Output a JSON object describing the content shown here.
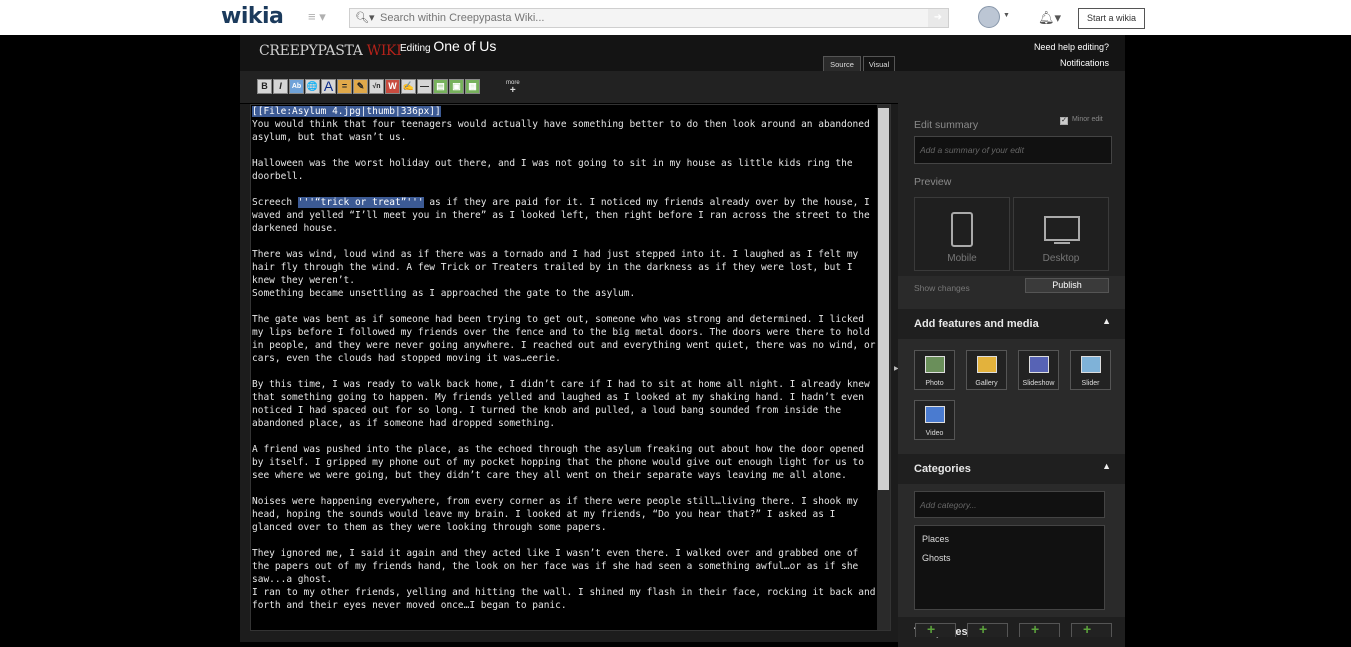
{
  "global_nav": {
    "logo": "wikia",
    "menu_icon": "≡ ▾",
    "search_placeholder": "Search within Creepypasta Wiki...",
    "start_wiki": "Start a wikia"
  },
  "header": {
    "wiki_name_part1": "CREEPYPASTA ",
    "wiki_name_part2": "WIKI",
    "editing_label": "Editing",
    "page_title": "One of Us",
    "help_link": "Need help editing?",
    "notifications": "Notifications"
  },
  "tabs": {
    "source": "Source",
    "visual": "Visual"
  },
  "toolbar": {
    "more_label": "more",
    "more_plus": "+",
    "buttons": [
      "B",
      "I",
      "Ab",
      "🌐",
      "A",
      "=",
      "✎",
      "√n",
      "W",
      "✍",
      "—",
      "▤",
      "▣",
      "▦"
    ]
  },
  "editor": {
    "lines": [
      {
        "pre": "",
        "hl": "[[File:Asylum 4.jpg|thumb|336px]]",
        "post": "\nYou would think that four teenagers would actually have something better to do then look around an abandoned asylum, but that wasn’t us."
      },
      {
        "pre": "Halloween was the worst holiday out there, and I was not going to sit in my house as little kids ring the doorbell.",
        "hl": "",
        "post": ""
      },
      {
        "pre": "Screech ",
        "hl": "'''“trick or treat”'''",
        "post": " as if they are paid for it. I noticed my friends already over by the house, I waved and yelled “I’ll meet you in there” as I looked left, then right before I ran across the street to the darkened house."
      },
      {
        "pre": "There was wind, loud wind as if there was a tornado and I had just stepped into it. I laughed as I felt my hair fly through the wind. A few Trick or Treaters trailed by in the darkness as if they were lost, but I knew they weren’t.\nSomething became unsettling as I approached the gate to the asylum.",
        "hl": "",
        "post": ""
      },
      {
        "pre": "The gate was bent as if someone had been trying to get out, someone who was strong and determined. I licked my lips before I followed my friends over the fence and to the big metal doors. The doors were there to hold in people, and they were never going anywhere. I reached out and everything went quiet, there was no wind, or cars, even the clouds had stopped moving it was…eerie.",
        "hl": "",
        "post": ""
      },
      {
        "pre": "By this time, I was ready to walk back home, I didn’t care if I had to sit at home all night. I already knew that something going to happen. My friends yelled and laughed as I looked at my shaking hand. I hadn’t even noticed I had spaced out for so long. I turned the knob and pulled, a loud bang sounded from inside the abandoned place, as if someone had dropped something.",
        "hl": "",
        "post": ""
      },
      {
        "pre": "A friend was pushed into the place, as the echoed through the asylum freaking out about how the door opened by itself. I gripped my phone out of my pocket hopping that the phone would give out enough light for us to see where we were going, but they didn’t care they all went on their separate ways leaving me all alone.",
        "hl": "",
        "post": ""
      },
      {
        "pre": "Noises were happening everywhere, from every corner as if there were people still…living there. I shook my head, hoping the sounds would leave my brain. I looked at my friends, “Do you hear that?” I asked as I glanced over to them as they were looking through some papers.",
        "hl": "",
        "post": ""
      },
      {
        "pre": "They ignored me, I said it again and they acted like I wasn’t even there. I walked over and grabbed one of the papers out of my friends hand, the look on her face was if she had seen a something awful…or as if she saw...a ghost.\nI ran to my other friends, yelling and hitting the wall. I shined my flash in their face, rocking it back and forth and their eyes never moved once…I began to panic.",
        "hl": "",
        "post": ""
      }
    ]
  },
  "rail": {
    "edit_summary_label": "Edit summary",
    "minor_edit": "Minor edit",
    "summary_placeholder": "Add a summary of your edit",
    "preview_label": "Preview",
    "mobile": "Mobile",
    "desktop": "Desktop",
    "show_changes": "Show changes",
    "publish": "Publish",
    "features_title": "Add features and media",
    "media": [
      "Photo",
      "Gallery",
      "Slideshow",
      "Slider",
      "Video"
    ],
    "categories_title": "Categories",
    "category_placeholder": "Add category...",
    "categories": [
      "Places",
      "Ghosts"
    ],
    "templates_title": "Templates",
    "collapse_glyph": "▲"
  }
}
